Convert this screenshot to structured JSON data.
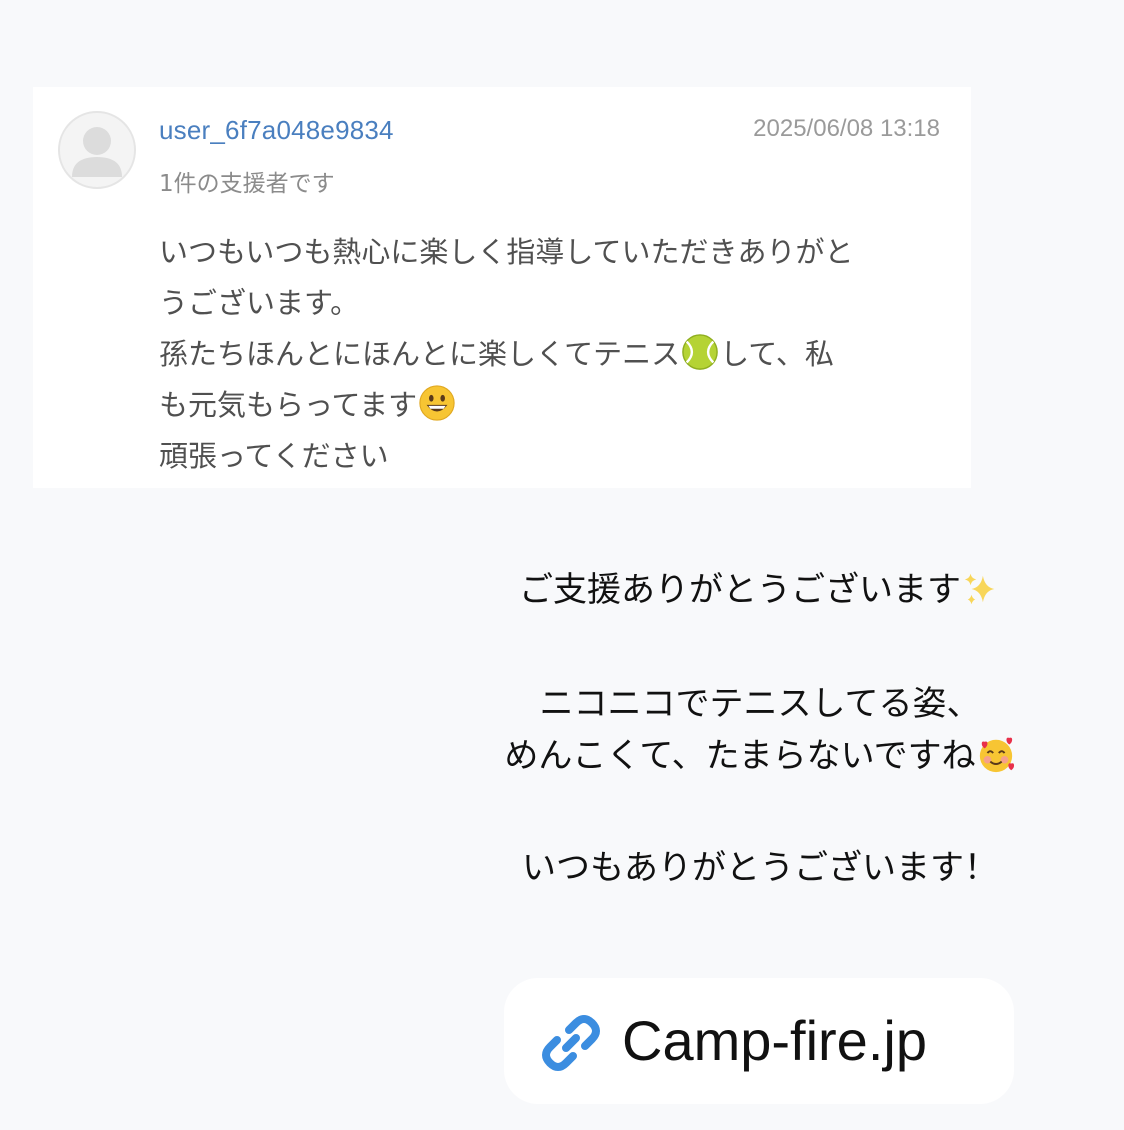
{
  "comment": {
    "username": "user_6f7a048e9834",
    "timestamp": "2025/06/08 13:18",
    "supporter_note": "1件の支援者です",
    "message": {
      "line1": "いつもいつも熱心に楽しく指導していただきありがと",
      "line2": "うございます。",
      "line3a": "孫たちほんとにほんとに楽しくてテニス",
      "line3b": "して、私",
      "line4": "も元気もらってます",
      "line5": "頑張ってください"
    },
    "emoji_icons": [
      "tennis-ball-icon",
      "grinning-face-icon"
    ]
  },
  "reply": {
    "line1": "ご支援ありがとうございます",
    "line2": "ニコニコでテニスしてる姿、",
    "line3": "めんこくて、たまらないですね",
    "line4": "いつもありがとうございます！",
    "emoji_icons": [
      "sparkles-icon",
      "smiling-face-with-hearts-icon"
    ]
  },
  "link": {
    "label": "Camp-fire.jp",
    "icon": "link-icon"
  },
  "colors": {
    "background": "#f8f9fb",
    "username": "#4a7fbf",
    "link_icon": "#3b8de0"
  }
}
